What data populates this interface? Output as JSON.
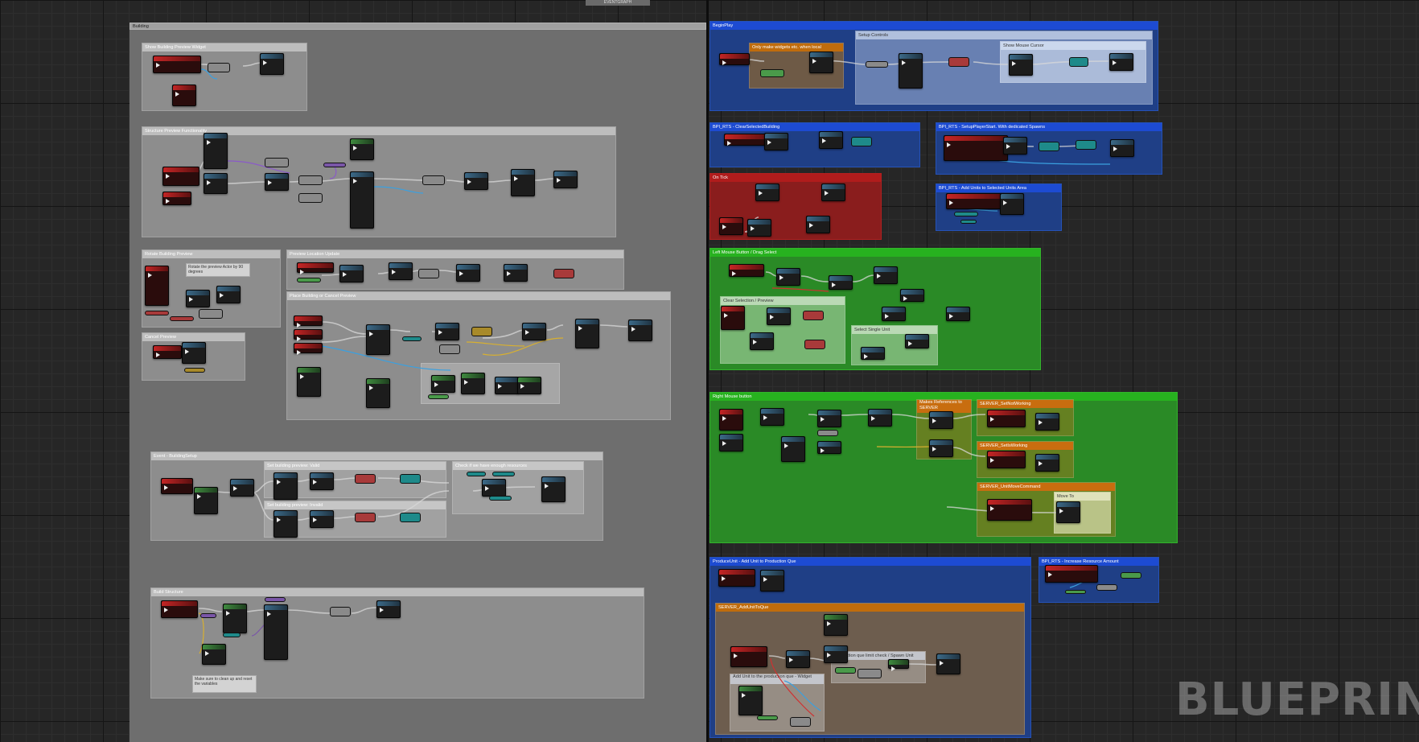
{
  "graph_title": "EVENTGRAPH",
  "watermark": "BLUEPRINT",
  "colors": {
    "grid_bg": "#262626",
    "blue_comment": "#1d4bd2",
    "red_comment": "#b01c1c",
    "green_comment": "#27b21f",
    "orange_comment": "#c86d0f"
  },
  "left": {
    "main": "Building",
    "c1": "Show Building Preview Widget",
    "c2": "Structure Preview Functionality",
    "c3": "Rotate Building Preview",
    "c3_note": "Rotate the preview Actor by 90 degrees",
    "c4": "Preview Location Update",
    "c5": "Place Building or Cancel Preview",
    "c6": "Cancel Preview",
    "c7": "Event - BuildingSetup",
    "c7a": "Set building preview: Valid",
    "c7b": "Set building preview: Invalid",
    "c7c": "Check if we have enough resources",
    "c8": "Build Structure",
    "c8_note": "Make sure to clean up and reset the variables"
  },
  "right": {
    "beginplay": "BeginPlay",
    "widgets_local": "Only make widgets etc. when local",
    "setup_controls": "Setup Controls",
    "show_mouse": "Show Mouse Cursor",
    "clear_building": "BPI_RTS - ClearSelectedBuilding",
    "setup_player": "BPI_RTS - SetupPlayerStart. With dedicated Spawns",
    "on_tick": "On Tick",
    "add_units": "BPI_RTS - Add Units to Selected Units Area",
    "left_mouse": "Left Mouse Button / Drag Select",
    "left_mouse_preview": "Clear Selection / Preview",
    "select_unit": "Select Single Unit",
    "right_mouse": "Right Mouse button",
    "makes_refs": "Makes References to SERVER",
    "srv_not_working": "SERVER_SetNotWorking",
    "srv_working": "SERVER_SetIsWorking",
    "srv_move": "SERVER_UnitMoveCommand",
    "srv_move_sub": "Move To",
    "produce_unit": "ProduceUnit - Add Unit to Production Que",
    "increase_resource": "BPI_RTS - Increase Resource Amount",
    "srv_add_unit": "SERVER_AddUnitToQue",
    "que_check": "Production que limit check / Spawn Unit",
    "que_add": "Add Unit to the production que - Widget"
  }
}
